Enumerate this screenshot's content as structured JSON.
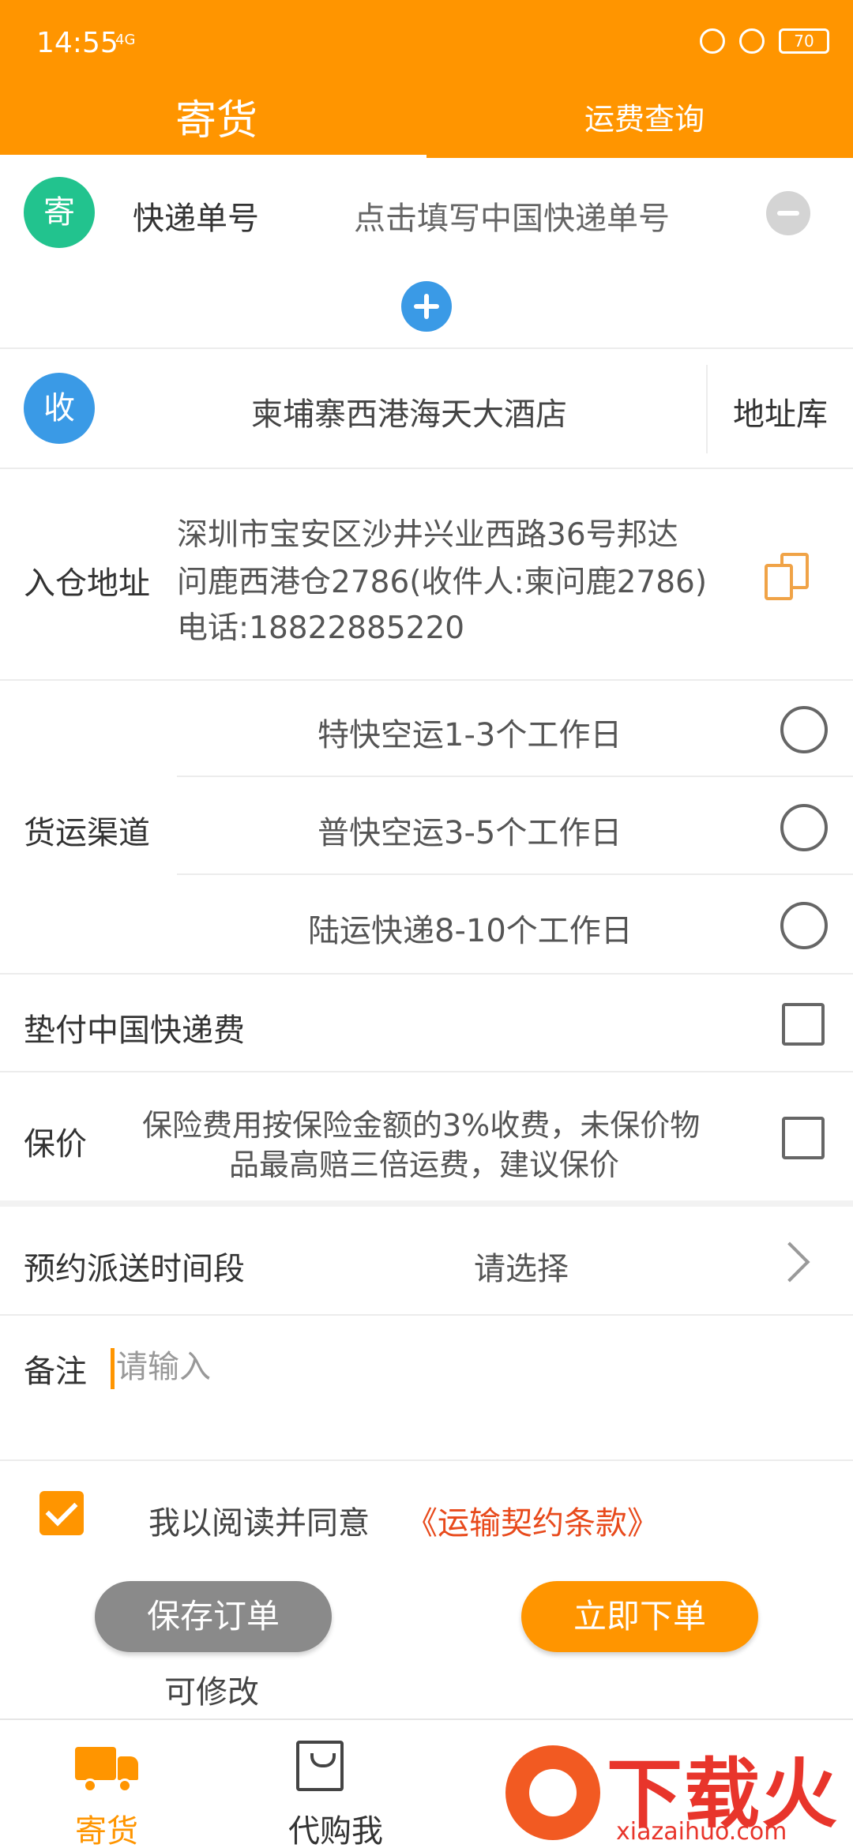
{
  "status_bar": {
    "time": "14:55",
    "signal": "4G",
    "battery": "70"
  },
  "header": {
    "tab_send": "寄货",
    "tab_freight": "运费查询"
  },
  "tracking": {
    "badge": "寄",
    "label": "快递单号",
    "placeholder": "点击填写中国快递单号"
  },
  "receiver": {
    "badge": "收",
    "name": "柬埔寨西港海天大酒店",
    "address_book": "地址库"
  },
  "warehouse": {
    "label": "入仓地址",
    "line1": "深圳市宝安区沙井兴业西路36号邦达",
    "line2": "问鹿西港仓2786(收件人:柬问鹿2786)",
    "line3": "电话:18822885220"
  },
  "channel": {
    "label": "货运渠道",
    "options": [
      "特快空运1-3个工作日",
      "普快空运3-5个工作日",
      "陆运快递8-10个工作日"
    ]
  },
  "prepay": {
    "label": "垫付中国快递费"
  },
  "insurance": {
    "label": "保价",
    "desc1": "保险费用按保险金额的3%收费，未保价物",
    "desc2": "品最高赔三倍运费，建议保价"
  },
  "delivery_time": {
    "label": "预约派送时间段",
    "value": "请选择"
  },
  "remark": {
    "label": "备注",
    "placeholder": "请输入"
  },
  "agreement": {
    "text": "我以阅读并同意",
    "link": "《运输契约条款》"
  },
  "actions": {
    "save": "保存订单",
    "save_hint": "可修改",
    "order": "立即下单"
  },
  "bottom_nav": {
    "send": "寄货",
    "purchase": "代购",
    "me": "我"
  },
  "watermark": {
    "title": "下载火",
    "sub": "xiazaihuo.com"
  },
  "colors": {
    "primary": "#ff9500",
    "blue": "#3a9ae6",
    "green": "#22c38e",
    "link_red": "#e84a1c"
  }
}
